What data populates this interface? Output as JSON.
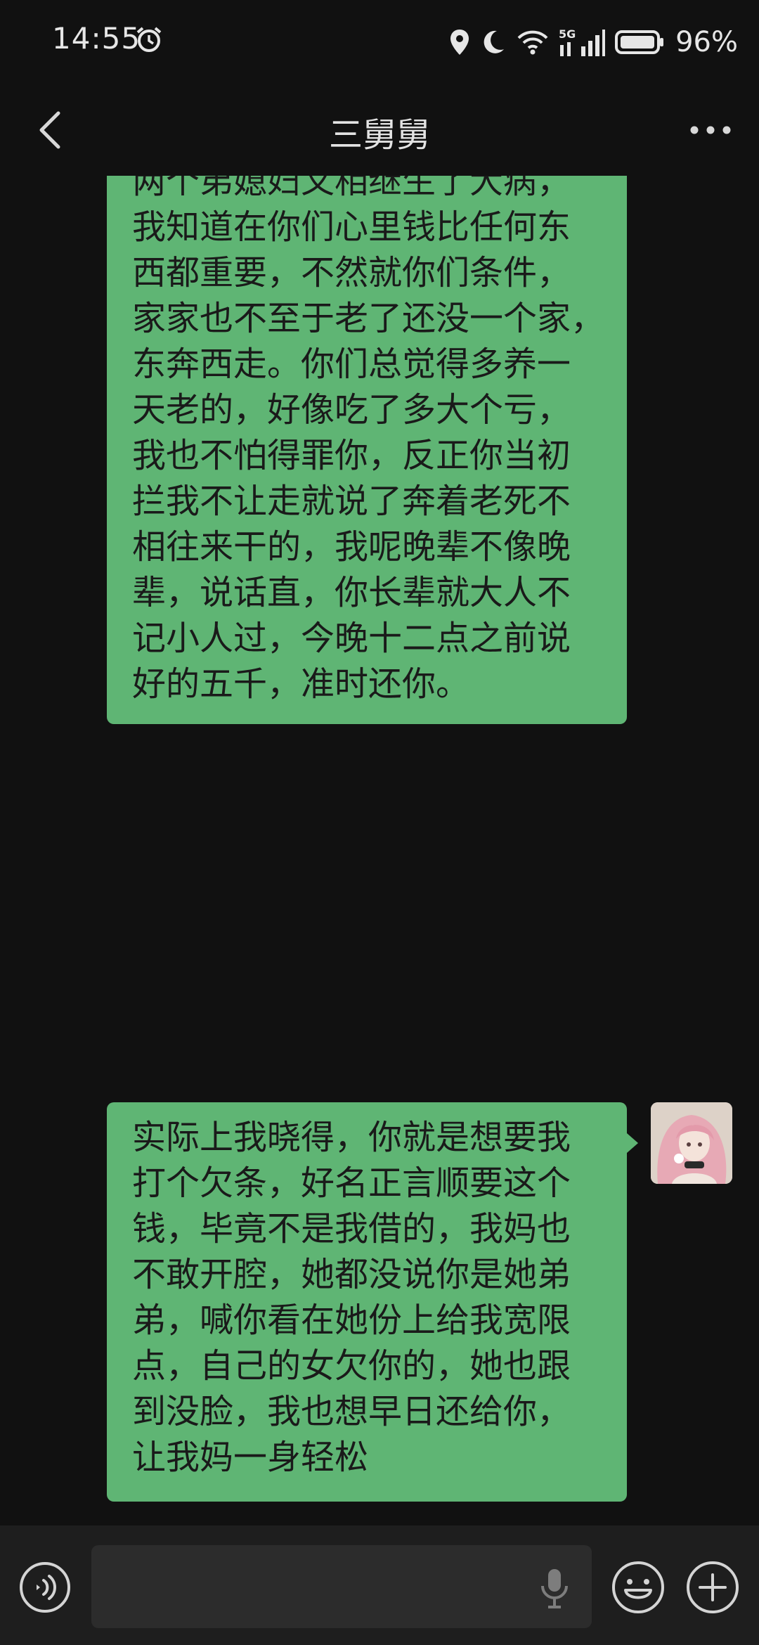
{
  "status_bar": {
    "time": "14:55",
    "battery": "96%",
    "network": "5G"
  },
  "header": {
    "title": "三舅舅"
  },
  "messages": [
    {
      "sender": "me",
      "text": "这钱我认，但是我觉得你做的\n最过分的就是，那这个事去影\n响我妈，搞得妈心里压力大，\n她宫颈癌手术后身体也不好，\n她也给我说过很多次，一年盼\n一年想到柑子卖点钱，帮我把\n钱还给你，但是最近几年柑子\n都没挣钱，保本都不错，后来\n两个弟媳妇又相继生了大病，\n我知道在你们心里钱比任何东\n西都重要，不然就你们条件，\n家家也不至于老了还没一个家，\n东奔西走。你们总觉得多养一\n天老的，好像吃了多大个亏，\n我也不怕得罪你，反正你当初\n拦我不让走就说了奔着老死不\n相往来干的，我呢晚辈不像晚\n辈，说话直，你长辈就大人不\n记小人过，今晚十二点之前说\n好的五千，准时还你。"
    },
    {
      "sender": "me",
      "text": "实际上我晓得，你就是想要我\n打个欠条，好名正言顺要这个\n钱，毕竟不是我借的，我妈也\n不敢开腔，她都没说你是她弟\n弟，喊你看在她份上给我宽限\n点，自己的女欠你的，她也跟\n到没脸，我也想早日还给你，\n让我妈一身轻松"
    }
  ],
  "input": {
    "value": "",
    "placeholder": ""
  },
  "colors": {
    "background": "#111111",
    "bubble": "#5fb574",
    "input_bar": "#1e1e1e"
  },
  "icons": [
    "back-arrow-icon",
    "more-dots-icon",
    "voice-icon",
    "mic-icon",
    "emoji-icon",
    "plus-icon"
  ]
}
